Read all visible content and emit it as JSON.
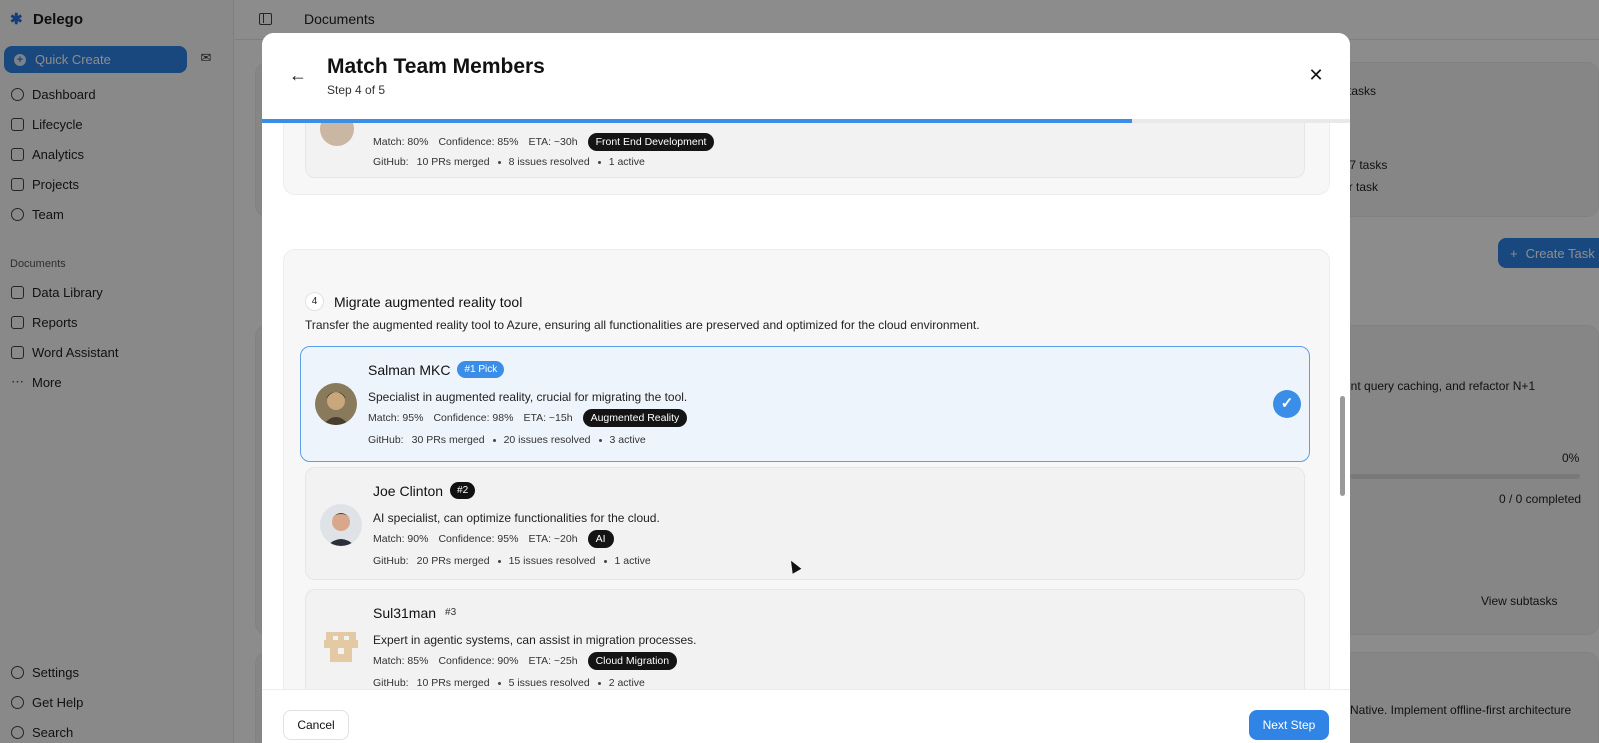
{
  "app": {
    "brand": "Delego",
    "quick_create": "Quick Create",
    "nav": [
      {
        "label": "Dashboard",
        "icon": "dashboard-icon"
      },
      {
        "label": "Lifecycle",
        "icon": "lifecycle-icon"
      },
      {
        "label": "Analytics",
        "icon": "analytics-icon"
      },
      {
        "label": "Projects",
        "icon": "folder-icon"
      },
      {
        "label": "Team",
        "icon": "team-icon"
      }
    ],
    "documents_section": "Documents",
    "doc_nav": [
      {
        "label": "Data Library",
        "icon": "database-icon"
      },
      {
        "label": "Reports",
        "icon": "reports-icon"
      },
      {
        "label": "Word Assistant",
        "icon": "word-icon"
      },
      {
        "label": "More",
        "icon": "more-icon"
      }
    ],
    "bottom_nav": [
      {
        "label": "Settings",
        "icon": "gear-icon"
      },
      {
        "label": "Get Help",
        "icon": "help-icon"
      },
      {
        "label": "Search",
        "icon": "search-icon"
      }
    ],
    "page_title": "Documents",
    "background_fragments": {
      "tasks": "tasks",
      "seven_tasks": "s 7 tasks",
      "er_task": "er task",
      "create_task": "Create Task",
      "query_caching": "ent query caching, and refactor N+1",
      "percent": "0%",
      "completed": "0 / 0 completed",
      "view_subtasks": "View subtasks",
      "native": "Native. Implement offline-first architecture"
    }
  },
  "modal": {
    "title": "Match Team Members",
    "step": "Step 4 of 5",
    "progress": 0.8,
    "previous_candidate": {
      "match": "Match: 80%",
      "confidence": "Confidence: 85%",
      "eta": "ETA: ~30h",
      "skill": "Front End Development",
      "github_label": "GitHub:",
      "prs": "10 PRs merged",
      "issues": "8 issues resolved",
      "active": "1 active"
    },
    "task": {
      "number": "4",
      "title": "Migrate augmented reality tool",
      "description": "Transfer the augmented reality tool to Azure, ensuring all functionalities are preserved and optimized for the cloud environment.",
      "candidates": [
        {
          "name": "Salman MKC",
          "rank": "#1 Pick",
          "summary": "Specialist in augmented reality, crucial for migrating the tool.",
          "match": "Match: 95%",
          "confidence": "Confidence: 98%",
          "eta": "ETA: ~15h",
          "skill": "Augmented Reality",
          "github_label": "GitHub:",
          "prs": "30 PRs merged",
          "issues": "20 issues resolved",
          "active": "3 active",
          "selected": true
        },
        {
          "name": "Joe Clinton",
          "rank": "#2",
          "summary": "AI specialist, can optimize functionalities for the cloud.",
          "match": "Match: 90%",
          "confidence": "Confidence: 95%",
          "eta": "ETA: ~20h",
          "skill": "AI",
          "github_label": "GitHub:",
          "prs": "20 PRs merged",
          "issues": "15 issues resolved",
          "active": "1 active",
          "selected": false
        },
        {
          "name": "Sul31man",
          "rank": "#3",
          "summary": "Expert in agentic systems, can assist in migration processes.",
          "match": "Match: 85%",
          "confidence": "Confidence: 90%",
          "eta": "ETA: ~25h",
          "skill": "Cloud Migration",
          "github_label": "GitHub:",
          "prs": "10 PRs merged",
          "issues": "5 issues resolved",
          "active": "2 active",
          "selected": false
        }
      ]
    },
    "cancel": "Cancel",
    "next": "Next Step"
  },
  "colors": {
    "accent": "#2f84e6",
    "selected_bg": "#eef4fb",
    "tag_bg": "#141414"
  }
}
